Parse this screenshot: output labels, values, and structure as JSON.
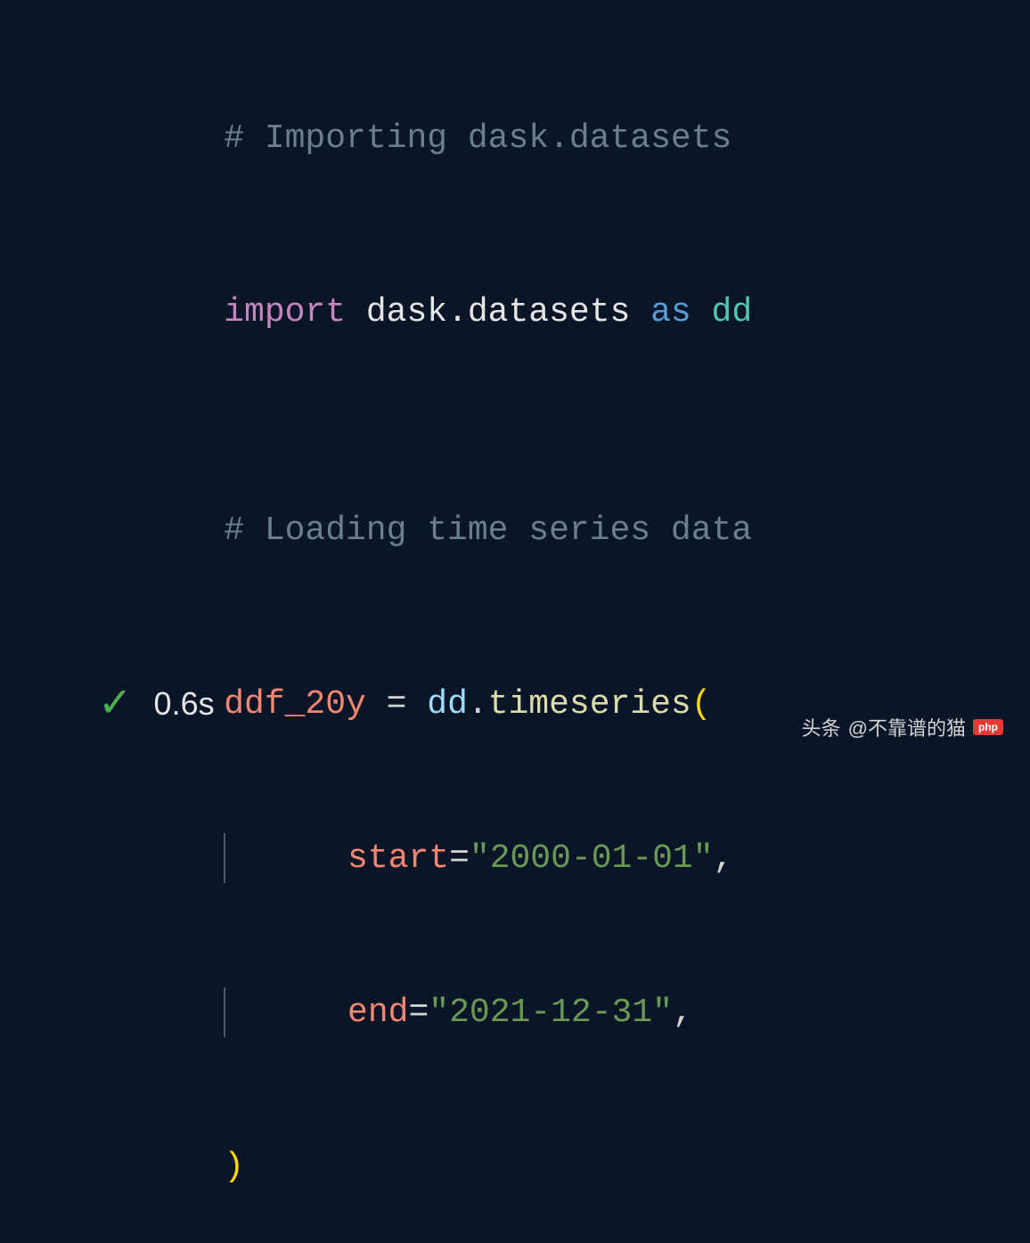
{
  "code": {
    "comment1": "# Importing dask.datasets",
    "import_kw": "import",
    "module": "dask.datasets",
    "as_kw": "as",
    "alias": "dd",
    "comment2": "# Loading time series data",
    "var": "ddf_20y",
    "equals": " = ",
    "obj": "dd",
    "dot": ".",
    "func": "timeseries",
    "open_paren": "(",
    "param1": "start",
    "eq1": "=",
    "val1": "\"2000-01-01\"",
    "comma1": ",",
    "param2": "end",
    "eq2": "=",
    "val2": "\"2021-12-31\"",
    "comma2": ",",
    "close_paren": ")"
  },
  "status": {
    "checkmark": "✓",
    "time": "0.6s"
  },
  "watermark": {
    "label": "头条",
    "handle": "@不靠谱的猫",
    "logo": "php"
  }
}
